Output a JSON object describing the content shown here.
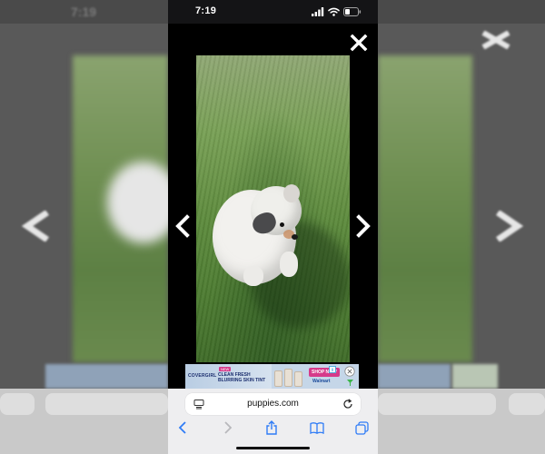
{
  "status_bar": {
    "time": "7:19",
    "icons": [
      "cellular-signal-icon",
      "wifi-icon",
      "battery-icon"
    ]
  },
  "viewer": {
    "controls": [
      "close-icon",
      "chevron-left-icon",
      "chevron-right-icon"
    ],
    "photo_subject": "puppy-photo"
  },
  "ad": {
    "badge": "NEW",
    "brand": "COVERGIRL",
    "headline": "CLEAN FRESH BLURRING SKIN TINT",
    "cta": "SHOP NOW",
    "store": "Walmart",
    "icons": [
      "ad-info-icon",
      "close-icon",
      "ad-choices-icon"
    ]
  },
  "browser": {
    "url": "puppies.com",
    "toolbar_icons": [
      "back-icon",
      "forward-icon",
      "share-icon",
      "bookmarks-icon",
      "tabs-icon"
    ]
  },
  "colors": {
    "accent": "#2f7cf6",
    "dimmed_background": "#5c5c5c",
    "status_bar": "#141416",
    "toolbar": "#eeeef0",
    "ad_cta": "#d63a8a"
  }
}
